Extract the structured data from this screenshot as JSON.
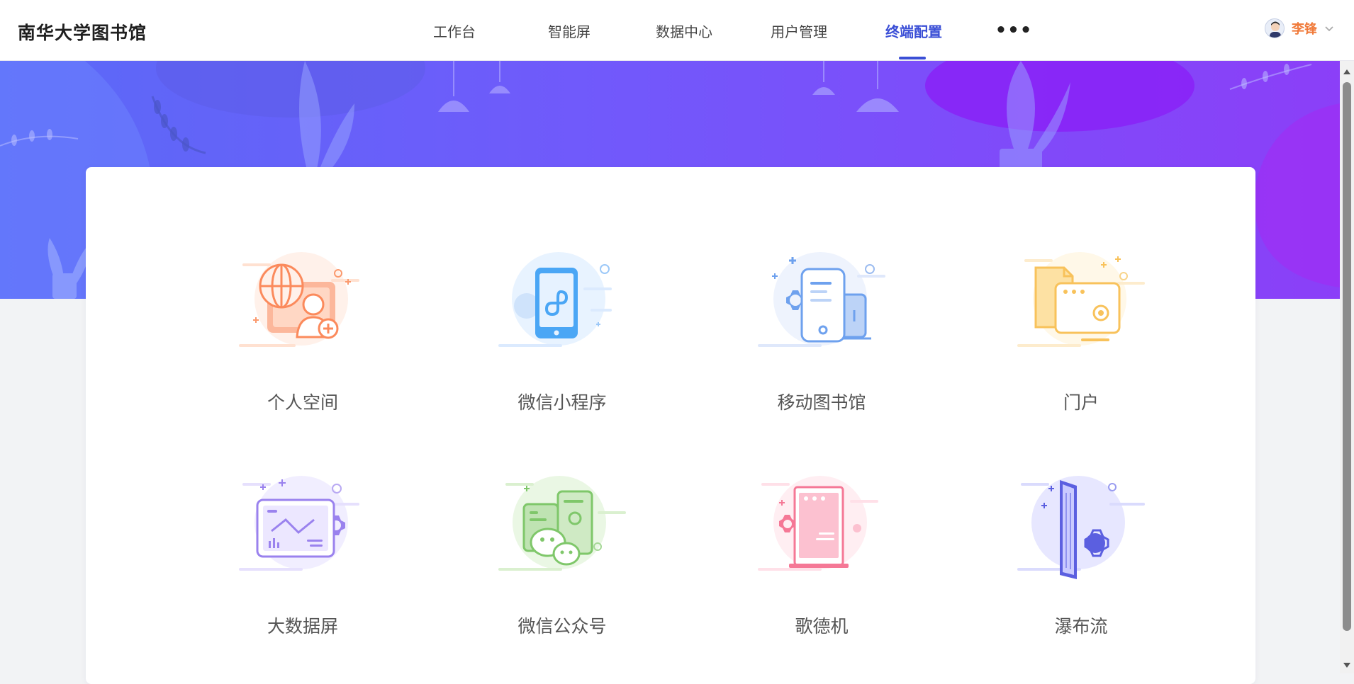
{
  "app": {
    "title": "南华大学图书馆"
  },
  "nav": {
    "items": [
      {
        "label": "工作台",
        "active": false
      },
      {
        "label": "智能屏",
        "active": false
      },
      {
        "label": "数据中心",
        "active": false
      },
      {
        "label": "用户管理",
        "active": false
      },
      {
        "label": "终端配置",
        "active": true
      }
    ],
    "more_label": "•••"
  },
  "user": {
    "name": "李锋"
  },
  "colors": {
    "accent": "#3b4fd6",
    "user_name": "#f07a3a",
    "banner_start": "#5a6af7",
    "banner_end": "#8b3ff8"
  },
  "terminals": [
    {
      "label": "个人空间",
      "icon": "personal-space-icon",
      "color": "#fb9a6e"
    },
    {
      "label": "微信小程序",
      "icon": "wechat-miniprogram-icon",
      "color": "#4aa6f5"
    },
    {
      "label": "移动图书馆",
      "icon": "mobile-library-icon",
      "color": "#6ea1ee"
    },
    {
      "label": "门户",
      "icon": "portal-icon",
      "color": "#f8c25b"
    },
    {
      "label": "大数据屏",
      "icon": "big-data-screen-icon",
      "color": "#9a82ee"
    },
    {
      "label": "微信公众号",
      "icon": "wechat-official-account-icon",
      "color": "#7fc76a"
    },
    {
      "label": "歌德机",
      "icon": "goethe-kiosk-icon",
      "color": "#f57896"
    },
    {
      "label": "瀑布流",
      "icon": "waterfall-screen-icon",
      "color": "#5b5fe0"
    }
  ]
}
